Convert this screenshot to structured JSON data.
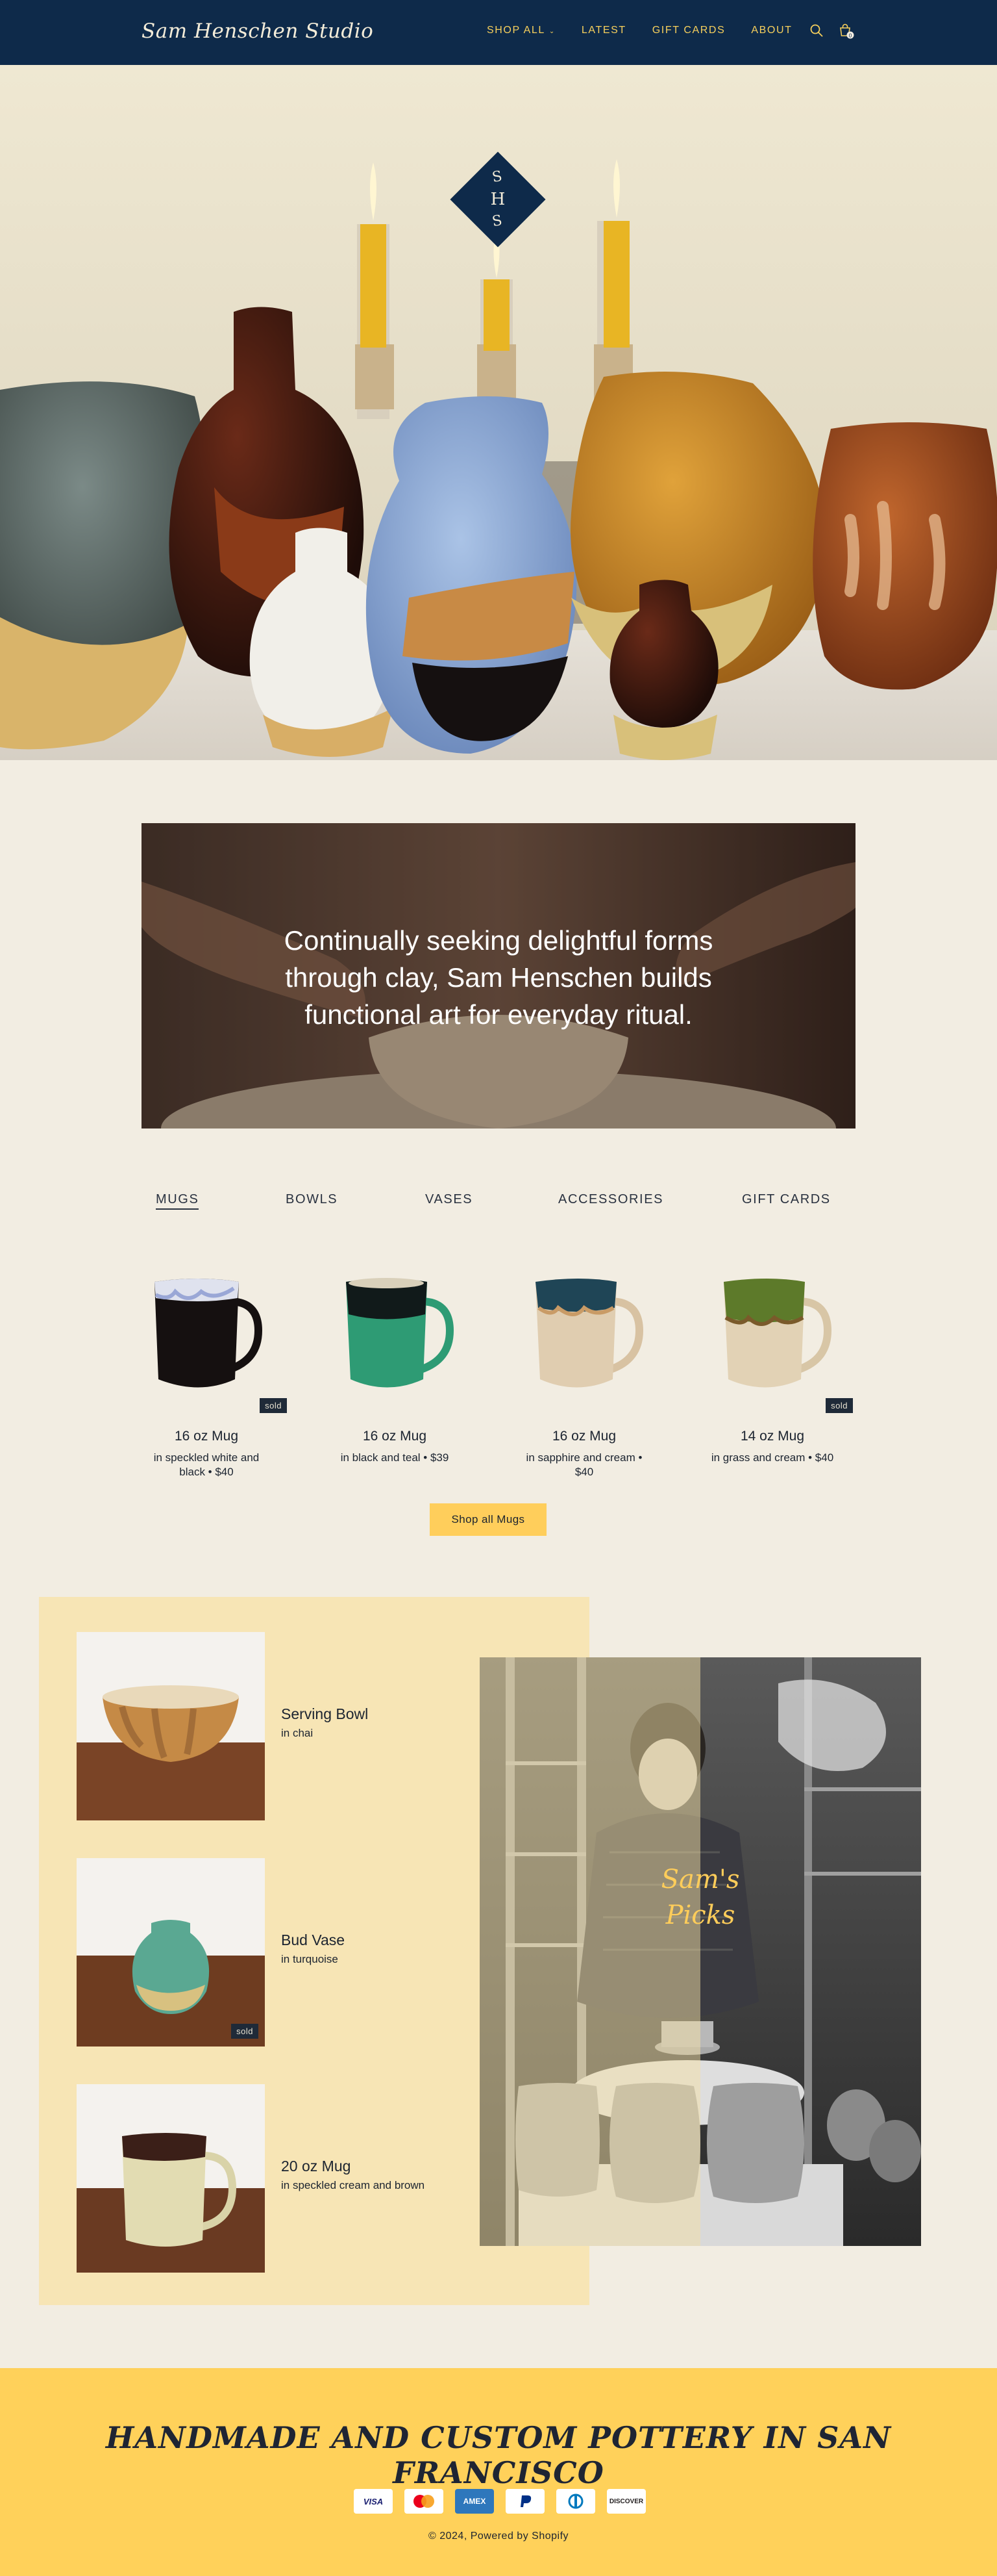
{
  "header": {
    "logo": "Sam Henschen Studio",
    "nav": [
      {
        "label": "SHOP ALL",
        "has_caret": true
      },
      {
        "label": "LATEST"
      },
      {
        "label": "GIFT CARDS"
      },
      {
        "label": "ABOUT"
      }
    ],
    "icons": [
      "search-icon",
      "cart-icon"
    ],
    "cart_count": "0"
  },
  "hero": {
    "monogram": "SHS"
  },
  "statement": {
    "text": "Continually seeking delightful forms through clay, Sam Henschen builds functional art for everyday ritual."
  },
  "tabs": [
    "MUGS",
    "BOWLS",
    "VASES",
    "ACCESSORIES",
    "GIFT CARDS"
  ],
  "products": [
    {
      "name": "16 oz Mug",
      "desc": "in speckled white and black • $40",
      "sold": "sold"
    },
    {
      "name": "16 oz Mug",
      "desc": "in black and teal • $39",
      "sold": ""
    },
    {
      "name": "16 oz Mug",
      "desc": "in sapphire and cream • $40",
      "sold": ""
    },
    {
      "name": "14 oz Mug",
      "desc": "in grass and cream • $40",
      "sold": "sold"
    }
  ],
  "shop_button": "Shop all Mugs",
  "picks": {
    "label": "Sam's Picks",
    "label_line1": "Sam's",
    "label_line2": "Picks",
    "items": [
      {
        "title": "Serving Bowl",
        "sub": "in chai",
        "sold": ""
      },
      {
        "title": "Bud Vase",
        "sub": "in turquoise",
        "sold": "sold"
      },
      {
        "title": "20 oz Mug",
        "sub": "in speckled cream and brown",
        "sold": ""
      }
    ]
  },
  "footer": {
    "tagline": "HANDMADE AND CUSTOM POTTERY IN SAN FRANCISCO",
    "payments": [
      "VISA",
      "mastercard",
      "AMEX",
      "PayPal",
      "Diners",
      "DISCOVER"
    ],
    "copyright": "© 2024, Powered by Shopify"
  },
  "colors": {
    "navy": "#0e2a4a",
    "gold": "#f6cf5c",
    "cream": "#f2ede2",
    "yellow": "#ffd15a",
    "pale_yellow": "#f7e5b5"
  }
}
